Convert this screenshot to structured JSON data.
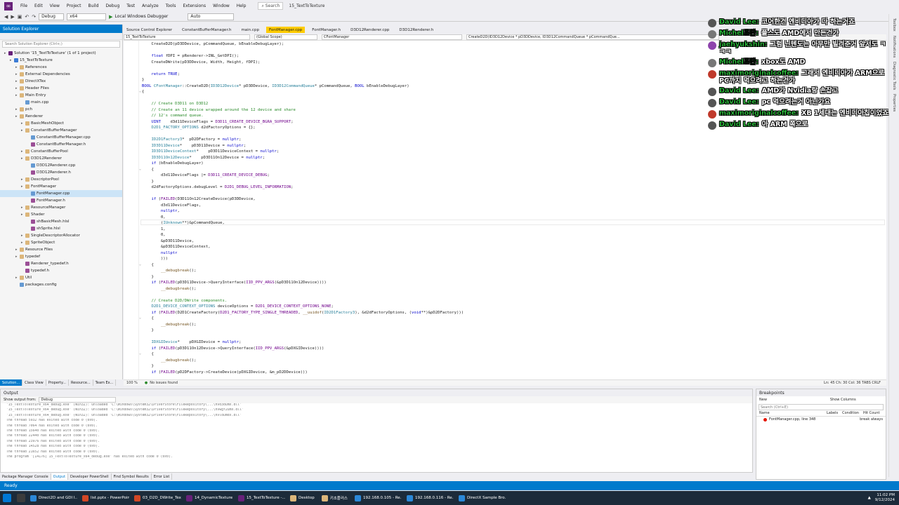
{
  "menu": {
    "items": [
      "File",
      "Edit",
      "View",
      "Project",
      "Build",
      "Debug",
      "Test",
      "Analyze",
      "Tools",
      "Extensions",
      "Window",
      "Help"
    ],
    "search": "Search",
    "solution_title": "15_TextToTexture",
    "copilot": "GitHub Copilot"
  },
  "toolbar": {
    "config": "Debug",
    "platform": "x64",
    "run_label": "Local Windows Debugger",
    "auto": "Auto"
  },
  "solution_explorer": {
    "title": "Solution Explorer",
    "search_placeholder": "Search Solution Explorer (Ctrl+;)",
    "items": [
      {
        "label": "Solution '15_TextToTexture' (1 of 1 project)",
        "indent": 0,
        "icon": "sln"
      },
      {
        "label": "15_TextToTexture",
        "indent": 1,
        "icon": "proj"
      },
      {
        "label": "References",
        "indent": 2,
        "icon": "folder"
      },
      {
        "label": "External Dependencies",
        "indent": 2,
        "icon": "folder"
      },
      {
        "label": "DirectXTex",
        "indent": 2,
        "icon": "folder"
      },
      {
        "label": "Header Files",
        "indent": 2,
        "icon": "folder"
      },
      {
        "label": "Main Entry",
        "indent": 2,
        "icon": "folder"
      },
      {
        "label": "main.cpp",
        "indent": 3,
        "icon": "cpp"
      },
      {
        "label": "pch",
        "indent": 2,
        "icon": "folder"
      },
      {
        "label": "Renderer",
        "indent": 2,
        "icon": "folder"
      },
      {
        "label": "BasicMeshObject",
        "indent": 3,
        "icon": "folder"
      },
      {
        "label": "ConstantBufferManager",
        "indent": 3,
        "icon": "folder"
      },
      {
        "label": "ConstantBufferManager.cpp",
        "indent": 4,
        "icon": "cpp"
      },
      {
        "label": "ConstantBufferManager.h",
        "indent": 4,
        "icon": "h"
      },
      {
        "label": "ConstantBufferPool",
        "indent": 3,
        "icon": "folder"
      },
      {
        "label": "D3D12Renderer",
        "indent": 3,
        "icon": "folder"
      },
      {
        "label": "D3D12Renderer.cpp",
        "indent": 4,
        "icon": "cpp"
      },
      {
        "label": "D3D12Renderer.h",
        "indent": 4,
        "icon": "h"
      },
      {
        "label": "DescriptorPool",
        "indent": 3,
        "icon": "folder"
      },
      {
        "label": "FontManager",
        "indent": 3,
        "icon": "folder"
      },
      {
        "label": "FontManager.cpp",
        "indent": 4,
        "icon": "cpp",
        "selected": true
      },
      {
        "label": "FontManager.h",
        "indent": 4,
        "icon": "h"
      },
      {
        "label": "ResourceManager",
        "indent": 3,
        "icon": "folder"
      },
      {
        "label": "Shader",
        "indent": 3,
        "icon": "folder"
      },
      {
        "label": "shBasicMesh.hlsl",
        "indent": 4,
        "icon": "h"
      },
      {
        "label": "shSprite.hlsl",
        "indent": 4,
        "icon": "h"
      },
      {
        "label": "SingleDescriptorAllocator",
        "indent": 3,
        "icon": "folder"
      },
      {
        "label": "SpriteObject",
        "indent": 3,
        "icon": "folder"
      },
      {
        "label": "Resource Files",
        "indent": 2,
        "icon": "folder"
      },
      {
        "label": "typedef",
        "indent": 2,
        "icon": "folder"
      },
      {
        "label": "Renderer_typedef.h",
        "indent": 3,
        "icon": "h"
      },
      {
        "label": "typedef.h",
        "indent": 3,
        "icon": "h"
      },
      {
        "label": "Util",
        "indent": 2,
        "icon": "folder"
      },
      {
        "label": "packages.config",
        "indent": 2,
        "icon": "cpp"
      }
    ],
    "tabs": [
      "Solution...",
      "Class View",
      "Property...",
      "Resource...",
      "Team Ex..."
    ]
  },
  "editor": {
    "tabs": [
      "Source Control Explorer",
      "ConstantBufferManager.h",
      "main.cpp",
      "FontManager.cpp",
      "FontManager.h",
      "D3D12Renderer.cpp",
      "D3D12Renderer.h"
    ],
    "active_tab": 3,
    "nav": [
      "15_TextToTexture",
      "(Global Scope)",
      "CFontManager",
      "CreateD2D(ID3D12Device * pD3DDevice, ID3D12CommandQueue * pCommandQue..."
    ],
    "zoom": "100 %",
    "issues": "No issues found",
    "position": "Ln: 45    Ch: 30    Col: 36    TABS    CRLF"
  },
  "code_lines": [
    "    CreateD2D(pD3DDevice, pCommandQueue, bEnableDebugLayer);",
    "",
    "    float fDPI = pRenderer->INL_GetDPI();",
    "    CreateDWrite(pD3DDevice, Width, Height, fDPI);",
    "",
    "    return TRUE;",
    "}",
    "BOOL CFontManager::CreateD2D(ID3D12Device* pD3DDevice, ID3D12CommandQueue* pCommandQueue, BOOL bEnableDebugLayer)",
    "{",
    "",
    "    // Create D3D11 on D3D12",
    "    // Create an 11 device wrapped around the 12 device and share",
    "    // 12's command queue.",
    "    UINT    d3d11DeviceFlags = D3D11_CREATE_DEVICE_BGRA_SUPPORT;",
    "    D2D1_FACTORY_OPTIONS d2dFactoryOptions = {};",
    "",
    "    ID2D1Factory3*  pD2DFactory = nullptr;",
    "    ID3D11Device*    pD3D11Device = nullptr;",
    "    ID3D11DeviceContext*    pD3D11DeviceContext = nullptr;",
    "    ID3D11On12Device*    pD3D11On12Device = nullptr;",
    "    if (bEnableDebugLayer)",
    "    {",
    "        d3d11DeviceFlags |= D3D11_CREATE_DEVICE_DEBUG;",
    "    }",
    "    d2dFactoryOptions.debugLevel = D2D1_DEBUG_LEVEL_INFORMATION;",
    "",
    "    if (FAILED(D3D11On12CreateDevice(pD3DDevice,",
    "        d3d11DeviceFlags,",
    "        nullptr,",
    "        0,",
    "        (IUnknown**)&pCommandQueue,",
    "        1,",
    "        0,",
    "        &pD3D11Device,",
    "        &pD3D11DeviceContext,",
    "        nullptr",
    "        )))",
    "    {",
    "        __debugbreak();",
    "    }",
    "    if (FAILED(pD3D11Device->QueryInterface(IID_PPV_ARGS(&pD3D11On12Device))))",
    "        __debugbreak();",
    "",
    "    // Create D2D/DWrite components.",
    "    D2D1_DEVICE_CONTEXT_OPTIONS deviceOptions = D2D1_DEVICE_CONTEXT_OPTIONS_NONE;",
    "    if (FAILED(D2D1CreateFactory(D2D1_FACTORY_TYPE_SINGLE_THREADED, __uuidof(ID2D1Factory3), &d2dFactoryOptions, (void**)&pD2DFactory)))",
    "    {",
    "        __debugbreak();",
    "    }",
    "",
    "    IDXGIDevice*    pDXGIDevice = nullptr;",
    "    if (FAILED(pD3D11On12Device->QueryInterface(IID_PPV_ARGS(&pDXGIDevice))))",
    "    {",
    "        __debugbreak();",
    "    }",
    "    if (FAILED(pD2DFactory->CreateDevice(pDXGIDevice, &m_pD2DDevice)))"
  ],
  "output": {
    "title": "Output",
    "show_from_label": "Show output from:",
    "show_from_value": "Debug",
    "lines": [
      "'15_TextToTexture_x64_debug.exe' (Win32): Unloaded 'C:\\Windows\\System32\\DriverStore\\FileRepository\\...\\nvd3dumx.dll'",
      "'15_TextToTexture_x64_debug.exe' (Win32): Unloaded 'C:\\Windows\\System32\\DriverStore\\FileRepository\\...\\nvwgf2umx.dll'",
      "'15_TextToTexture_x64_debug.exe' (Win32): Unloaded 'C:\\Windows\\System32\\DriverStore\\FileRepository\\...\\nvldumdx.dll'",
      "The thread 5932 has exited with code 0 (0x0).",
      "The thread 7064 has exited with code 0 (0x0).",
      "The thread 15640 has exited with code 0 (0x0).",
      "The thread 22440 has exited with code 0 (0x0).",
      "The thread 23976 has exited with code 0 (0x0).",
      "The thread 14528 has exited with code 0 (0x0).",
      "The thread 21652 has exited with code 0 (0x0).",
      "The program '[14176] 15_TextToTexture_x64_debug.exe' has exited with code 0 (0x0)."
    ],
    "tabs": [
      "Package Manager Console",
      "Output",
      "Developer PowerShell",
      "Find Symbol Results",
      "Error List"
    ]
  },
  "breakpoints": {
    "title": "Breakpoints",
    "new_label": "New",
    "show_columns": "Show Columns",
    "search_placeholder": "Search (Ctrl+E)",
    "headers": [
      "Name",
      "Labels",
      "Condition",
      "Hit Count"
    ],
    "row": {
      "name": "FontManager.cpp, line 348",
      "hit": "break always"
    }
  },
  "status": {
    "ready": "Ready"
  },
  "right_strip": [
    "Toolbox",
    "Notifications",
    "Diagnostic Tools",
    "Properties"
  ],
  "chat": [
    {
      "name": "David Lee:",
      "text": "코어한건 엔비디아가 다 하는거죠",
      "avatar_color": "#555555"
    },
    {
      "name": "Michel조단:",
      "text": "플스도 AMD에서 만든건가",
      "avatar_color": "#777777"
    },
    {
      "name": "jaehyukshin:",
      "text": "그럼 닌텐도는 아무만 빌려준거 앞서도 ㅋㅋㅋ",
      "avatar_color": "#8e44ad"
    },
    {
      "name": "Michel조단:",
      "text": "xbox도 AMD",
      "avatar_color": "#777777"
    },
    {
      "name": "maximoriginalcoffee:",
      "text": "그래서 엔비디아가 ARM으로 PC까지 먹으려고 하는건가",
      "avatar_color": "#c0392b"
    },
    {
      "name": "David Lee:",
      "text": "AMD가 Nvidia랑 손잡고",
      "avatar_color": "#555555"
    },
    {
      "name": "David Lee:",
      "text": "pc 먹으려는거 아닌가요",
      "avatar_color": "#555555"
    },
    {
      "name": "maximoriginalcoffee:",
      "text": "XB 1세대는 엔비디아칩이었죠",
      "avatar_color": "#c0392b"
    },
    {
      "name": "David Lee:",
      "text": "아 ARM 쪽으로",
      "avatar_color": "#555555"
    }
  ],
  "taskbar": {
    "tasks": [
      {
        "label": "Direct2D and GDI I...",
        "color": "#2b88d8"
      },
      {
        "label": "list.pptx - PowerPoint",
        "color": "#d24726"
      },
      {
        "label": "03_D2D_DWrite_Tex...",
        "color": "#d24726"
      },
      {
        "label": "14_DynamicTexture -...",
        "color": "#68217a"
      },
      {
        "label": "15_TextToTexture -...",
        "color": "#68217a"
      },
      {
        "label": "Desktop",
        "color": "#dcb67a"
      },
      {
        "label": "키초플러스",
        "color": "#dcb67a"
      },
      {
        "label": "192.168.0.105 - Re...",
        "color": "#2b88d8"
      },
      {
        "label": "192.168.0.116 - Re...",
        "color": "#2b88d8"
      },
      {
        "label": "DirectX Sample Bro...",
        "color": "#2b88d8"
      }
    ],
    "time": "11:02 PM",
    "date": "9/12/2024"
  }
}
